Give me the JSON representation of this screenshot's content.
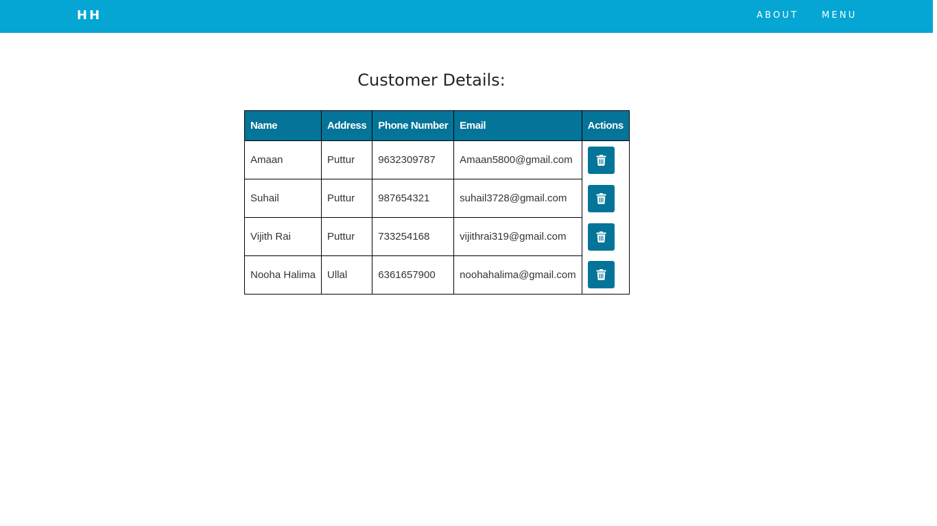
{
  "navbar": {
    "brand": "HH",
    "links": [
      "ABOUT",
      "MENU"
    ]
  },
  "page": {
    "title": "Customer Details:"
  },
  "table": {
    "columns": [
      "Name",
      "Address",
      "Phone Number",
      "Email",
      "Actions"
    ],
    "rows": [
      {
        "name": "Amaan",
        "address": "Puttur",
        "phone": "9632309787",
        "email": "Amaan5800@gmail.com",
        "action_icon": "trash-icon"
      },
      {
        "name": "Suhail",
        "address": "Puttur",
        "phone": "987654321",
        "email": "suhail3728@gmail.com",
        "action_icon": "trash-icon"
      },
      {
        "name": "Vijith Rai",
        "address": "Puttur",
        "phone": "733254168",
        "email": "vijithrai319@gmail.com",
        "action_icon": "trash-icon"
      },
      {
        "name": "Nooha Halima",
        "address": "Ullal",
        "phone": "6361657900",
        "email": "noohahalima@gmail.com",
        "action_icon": "trash-icon"
      }
    ]
  },
  "colors": {
    "navbar": "#05a6d4",
    "table_header": "#047499",
    "delete_button": "#047499"
  }
}
